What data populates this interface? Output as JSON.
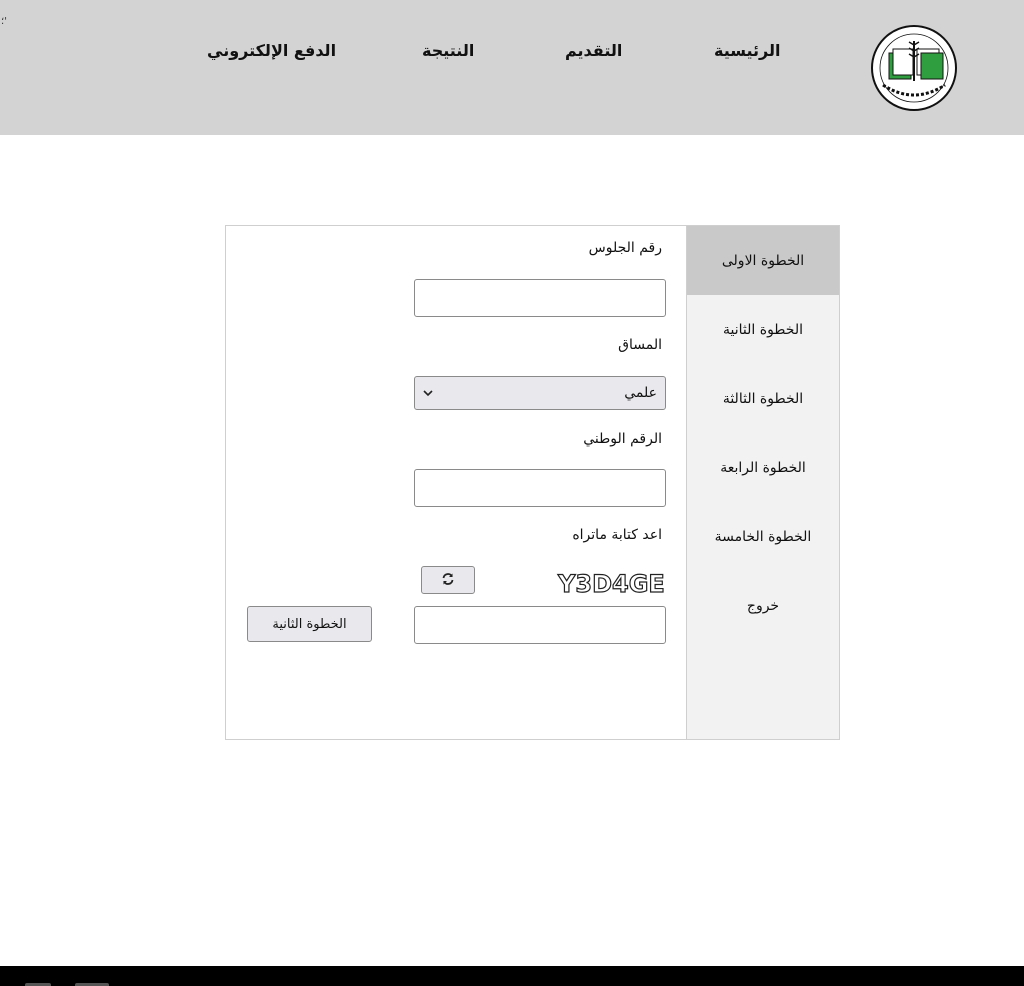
{
  "header": {
    "corner_mark": "؛'",
    "nav": [
      {
        "label": "الرئيسية"
      },
      {
        "label": "التقديم"
      },
      {
        "label": "النتيجة"
      },
      {
        "label": "الدفع الإلكتروني"
      }
    ],
    "logo_icon": "ministry-logo-icon"
  },
  "sidebar": {
    "steps": [
      {
        "label": "الخطوة الاولى",
        "active": true
      },
      {
        "label": "الخطوة الثانية"
      },
      {
        "label": "الخطوة الثالثة"
      },
      {
        "label": "الخطوة الرابعة"
      },
      {
        "label": "الخطوة الخامسة"
      },
      {
        "label": "خروج"
      }
    ]
  },
  "form": {
    "seat_number_label": "رقم الجلوس",
    "seat_number_value": "",
    "track_label": "المساق",
    "track_selected": "علمي",
    "national_id_label": "الرقم الوطني",
    "national_id_value": "",
    "captcha_label": "اعد كتابة ماتراه",
    "captcha_text": "Y3D4GE",
    "captcha_value": "",
    "refresh_icon": "refresh-icon",
    "next_label": "الخطوة الثانية"
  },
  "colors": {
    "header_bg": "#d3d3d3",
    "sidebar_bg": "#f2f2f2",
    "active_step_bg": "#c9c9c9",
    "logo_green": "#2e9e3e",
    "footer_bg": "#000000"
  }
}
